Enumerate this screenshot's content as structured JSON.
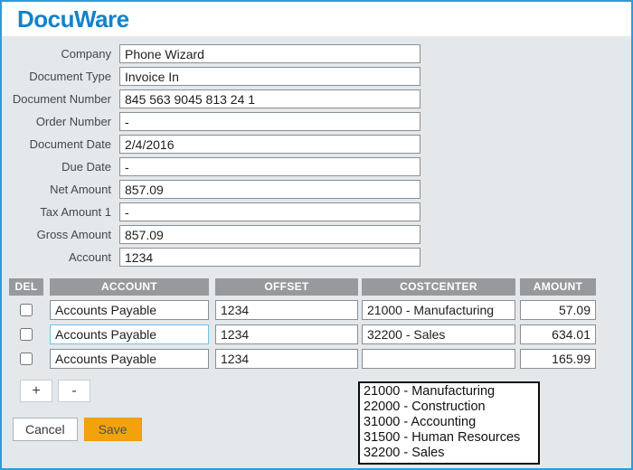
{
  "logo": {
    "text": "DocuWare"
  },
  "form": {
    "fields": [
      {
        "label": "Company",
        "value": "Phone Wizard"
      },
      {
        "label": "Document Type",
        "value": "Invoice In"
      },
      {
        "label": "Document Number",
        "value": "845 563 9045 813 24 1"
      },
      {
        "label": "Order Number",
        "value": "-"
      },
      {
        "label": "Document Date",
        "value": "2/4/2016"
      },
      {
        "label": "Due Date",
        "value": "-"
      },
      {
        "label": "Net Amount",
        "value": "857.09"
      },
      {
        "label": "Tax Amount 1",
        "value": "-"
      },
      {
        "label": "Gross Amount",
        "value": "857.09"
      },
      {
        "label": "Account",
        "value": "1234"
      }
    ]
  },
  "table": {
    "headers": [
      "DEL",
      "ACCOUNT",
      "OFFSET",
      "COSTCENTER",
      "AMOUNT"
    ],
    "rows": [
      {
        "account": "Accounts Payable",
        "offset": "1234",
        "costcenter": "21000 - Manufacturing",
        "amount": "57.09"
      },
      {
        "account": "Accounts Payable",
        "offset": "1234",
        "costcenter": "32200 - Sales",
        "amount": "634.01"
      },
      {
        "account": "Accounts Payable",
        "offset": "1234",
        "costcenter": "",
        "amount": "165.99"
      }
    ],
    "add_label": "+",
    "remove_label": "-"
  },
  "dropdown": {
    "options": [
      "21000 - Manufacturing",
      "22000 - Construction",
      "31000 - Accounting",
      "31500 - Human Resources",
      "32200 - Sales"
    ]
  },
  "actions": {
    "cancel_label": "Cancel",
    "save_label": "Save"
  },
  "colors": {
    "window_border_blue": "#2E9BD9",
    "logo_blue": "#1283CA",
    "table_header_gray": "#97999C",
    "save_orange": "#F2A30A",
    "focus_blue": "#6CC2EA",
    "panel_gray": "#E4E8EB"
  }
}
